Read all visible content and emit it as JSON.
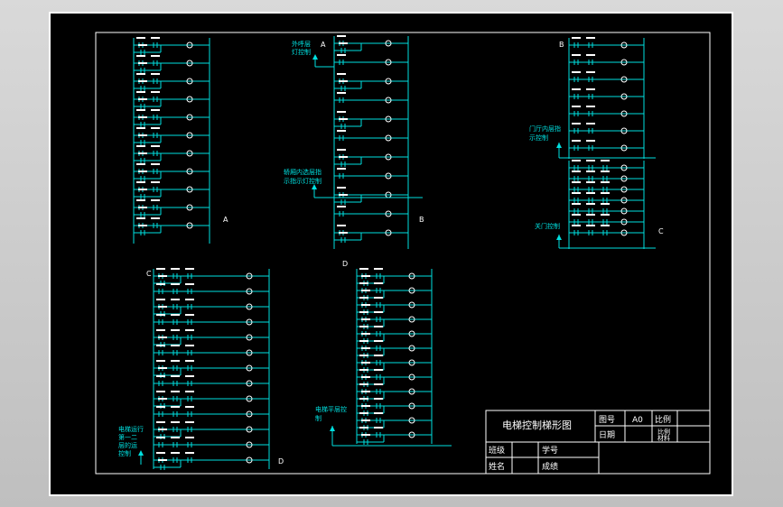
{
  "diagram": {
    "labels": {
      "A": "A",
      "B": "B",
      "C": "C",
      "D": "D"
    },
    "notes": {
      "b_top": [
        "外呼层",
        "灯控制"
      ],
      "b_mid": [
        "轿厢内选层指",
        "示指示灯控制"
      ],
      "c_top": [
        "门厅内层指",
        "示控制"
      ],
      "c_bot": [
        "关门控制"
      ],
      "d_mid": [
        "电梯平层控",
        "制"
      ],
      "c2_left": [
        "电梯运行",
        "第一二",
        "层的运",
        "控制"
      ]
    }
  },
  "title_block": {
    "title": "电梯控制梯形图",
    "drawing_no_label": "图号",
    "drawing_no_value": "A0",
    "scale_label": "比例",
    "date_label": "日期",
    "scale_value_1": "比例",
    "scale_value_2": "材料",
    "class_label": "班级",
    "student_id_label": "学号",
    "name_label": "姓名",
    "grade_label": "成绩"
  },
  "colors": {
    "wire": "#00e0e0",
    "border": "#ffffff",
    "background": "#000000"
  }
}
